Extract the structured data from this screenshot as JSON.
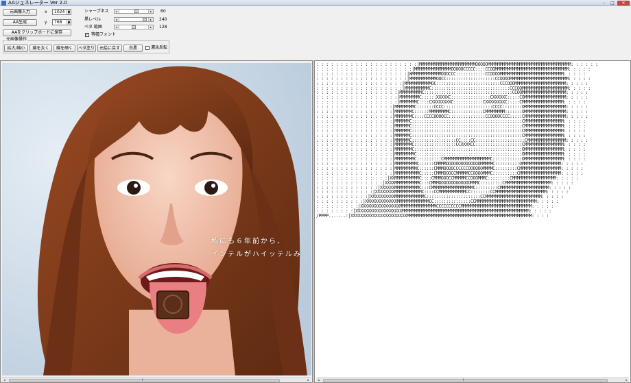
{
  "window": {
    "title": "AAジェネレーター Ver 2.0",
    "min": "–",
    "max": "□",
    "close": "✕"
  },
  "controls": {
    "load_button": "元画像入力",
    "generate_button": "AA生成",
    "save_button": "AAをクリップボードに保存",
    "x_label": "x",
    "x_value": "1024",
    "y_label": "y",
    "y_value": "768",
    "sliders": [
      {
        "label": "シャープネス",
        "value": "60",
        "fraction": 0.62
      },
      {
        "label": "黒レベル",
        "value": "240",
        "fraction": 0.94
      },
      {
        "label": "ベタ 範囲",
        "value": "128",
        "fraction": 0.5
      }
    ],
    "font_checkbox_label": "等幅フォント",
    "font_checkbox_checked": "✓"
  },
  "image_ops": {
    "group_label": "元画像操作",
    "buttons": [
      "拡大/縮小",
      "線を太く",
      "線を細く",
      "ベタ塗り",
      "元絵に戻す",
      "白黒"
    ],
    "reverse_label": "濃淡反転"
  },
  "photo": {
    "caption_line1": "私にも６年前から、",
    "caption_line2": "インテルがハイッテルみ"
  },
  "scrollbars": {
    "left_arrow": "◂",
    "right_arrow": "▸",
    "grip": "⁞"
  },
  "colors": {
    "hair": "#7a3a1d",
    "skin": "#f2c2ad",
    "background": "#cfdcea"
  },
  "aa_art": ": : : : : : : : : : : : : : : : : : : : :|MMMMMMMMMMMMMMMMMMMMMMMOOOOOMMMMMMMMMMMMMMMMMMMMMMMMMMMMMMMMMM: : : : : :\n: : : : : : : : : : : : : : : : : : : :|MMMMMMMMMMMMMMMOOOOOCCCCC::::CCOOMMMMMMMMMMMMMMMMMMMMMMMMMMMMMM: : : : :\n: : : : : : : : : : : : : : : : : : :|WMMMMMMMMMMMMOOOCCC::::::::::::CCOOOOMMMMMMMMMMMMMMMMMMMMMMMMMM: : : : :\n: : : : : : : : : : : : : : : : : : :|MMMMMMMMMMMOOCC::::::::::::::::::::CCOOOOMMMMMMMMMMMMMMMMMMMMMMMM: : : : :\n: : : : : : : : : : : : : : : : : :|MMMMMMMMMMMOC::::::::::::::::::::::::::CCCOOOMMMMMMMMMMMMMMMMMMMMM: : : : :\n: : : : : : : : : : : : : : : : : :|MMMMMMMMMMC::::::::::::::::::::::::::::::::CCCOOMMMMMMMMMMMMMMMMMMM: : : : :\n: : : : : : : : : : : : : : : : :|MMMMMMMMMC::::::::::::::::::::::::::::::::::::CCOOMMMMMMMMMMMMMMMMMM: : : : :\n: : : : : : : : : : : : : : : : :|MMMMMMMMC::::::XXXXXC::::::::::::::::CXXXXXC:::::COMMMMMMMMMMMMMMMMM: : : : :\n: : : : : : : : : : : : : : : : :|MMMMMMMC::::CXXXXXXXXC::::::::::::CXXXXXXXXC:::::CMMMMMMMMMMMMMMMMM: : : : :\n: : : : : : : : : : : : : : : :|MMMMMMMMC:::::::CCCC::::::::::::::::::::CCCC::::::::OMMMMMMMMMMMMMMMMM: : : : :\n: : : : : : : : : : : : : : : :|MMMMMMMC::::::MMMMMMMMC:::::::::::::CMMMMMMMM:::::::OMMMMMMMMMMMMMMMMM: : : : :\n: : : : : : : : : : : : : : : :|MMMMMMMC::::CCCCOOOOCC:::::::::::::::CCOOOOCCCC:::::CMMMMMMMMMMMMMMMMM: : : : :\n: : : : : : : : : : : : : : : :|MMMMMMC:::::::::::::::::::::::::::::::::::::::::::::CMMMMMMMMMMMMMMMM: : : : :\n: : : : : : : : : : : : : : : :|MMMMMMC:::::::::::::::::::::::::::::::::::::::::::::CMMMMMMMMMMMMMMMM: : : : :\n: : : : : : : : : : : : : : : :|MMMMMMC:::::::::::::::::::::::::::::::::::::::::::::CMMMMMMMMMMMMMMMM: : : : :\n: : : : : : : : : : : : : : : :|MMMMMMC:::::::::::::::::::::::::::::::::::::::::::::CMMMMMMMMMMMMMMMM: : : : :\n: : : : : : : : : : : : : : : :|MMMMMMC::::::::::::::::::CC::::CC::::::::::::::::::::CMMMMMMMMMMMMMMMM: : : : :\n: : : : : : : : : : : : : : : :|MMMMMMMC:::::::::::::::::CCXXXXCC:::::::::::::::::::CMMMMMMMMMMMMMMMM: : : : :\n: : : : : : : : : : : : : : : :|MMMMMMMC::::::::::::::::::::::::::::::::::::::::::::OMMMMMMMMMMMMMMMM: : : : :\n: : : : : : : : : : : : : : : :|MMMMMMMMC:::::::::::::::::::::::::::::::::::::::::::OMMMMMMMMMMMMMMMM: : : : :\n: : : : : : : : : : : : : : : :|MMMMMMMMC::::::::::CMMMMMMMMMMMMMMMMMMMC::::::::::::OMMMMMMMMMMMMMMMM: : : : :\n: : : : : : : : : : : : : : : :|MMMMMMMMMC::::::CMMMMOOOOOOOOOOOOOOMMMMMC::::::::::OMMMMMMMMMMMMMMMM: : : : :\n: : : : : : : : : : : : : : : :|MMMMMMMMMC::::::CMMMOOOOCCCCCCOOOOOOMMMMC:::::::::CMMMMMMMMMMMMMMMMM: : : : :\n: : : : : : : : : : : : : : : :|MMMMMMMMMMC:::::CMMMOOOCCMMMMMCCOOOOMMMC::::::::::CMMMMMMMMMMMMMMMMM: : : : :\n: : : : : : : : : : : : : : :|XXMMMMMMMMMMC::::CMMMOOOCCMMMMMCCOOOMMMC:::::::::CMMMMMMMMMMMMMMMMMM: : : : :\n: : : : : : : : : : : : : :|XXXXMMMMMMMMMMC:::CMMMOOOOOOOOOOOOOMMMC:::::::::CMMMMMMMMMMMMMMMMMMM: : : : :\n: : : : : : : : : : : : :|XXXXXXMMMMMMMMMMC:::CMMMMMMMMMMMMMMMMMC:::::::::CMMMMMMMMMMMMMMMMMMMM: : : : :\n: : : : : : : : : : : :|XXXXXXXXMMMMMMMMMMMC::::CCMMMMMMMMMMMCC::::::::CCMMMMMMMMMMMMMMMMMMMMM: : : : :\n: : : : : : : : : : :|XXXXXXXXXXMMMMMMMMMMMMC::::::::::::::::::::::CCMMMMMMMMMMMMMMMMMMMMMMM: : : : :\n: : : : : : : : : :|XXXXXXXXXXXXXMMMMMMMMMMMMMCC:::::::::::::::CCMMMMMMMMMMMMMMMMMMMMMMMMM: : : : :\n: : : : : : : : :|XXXXXXXXXXXXXXXXMMMMMMMMMMMMMMMCCCCCCCCCCMMMMMMMMMMMMMMMMMMMMMMMMMMMMM: : : : :\n: : : : : : : :|XXXXXXXXXXXXXXXXXXXMMMMMMMMMMMMMMMMMMMMMMMMMMMMMMMMMMMMMMMMMMMMMMMMMMMM: : : : :\n/PPPP.......:|XXXXXXXXXXXXXXXXXXXXXXXMMMMMMMMMMMMMMMMMMMMMMMMMMMMMMMMMMMMMMMMMMMMMMMMMMM: : : :"
}
